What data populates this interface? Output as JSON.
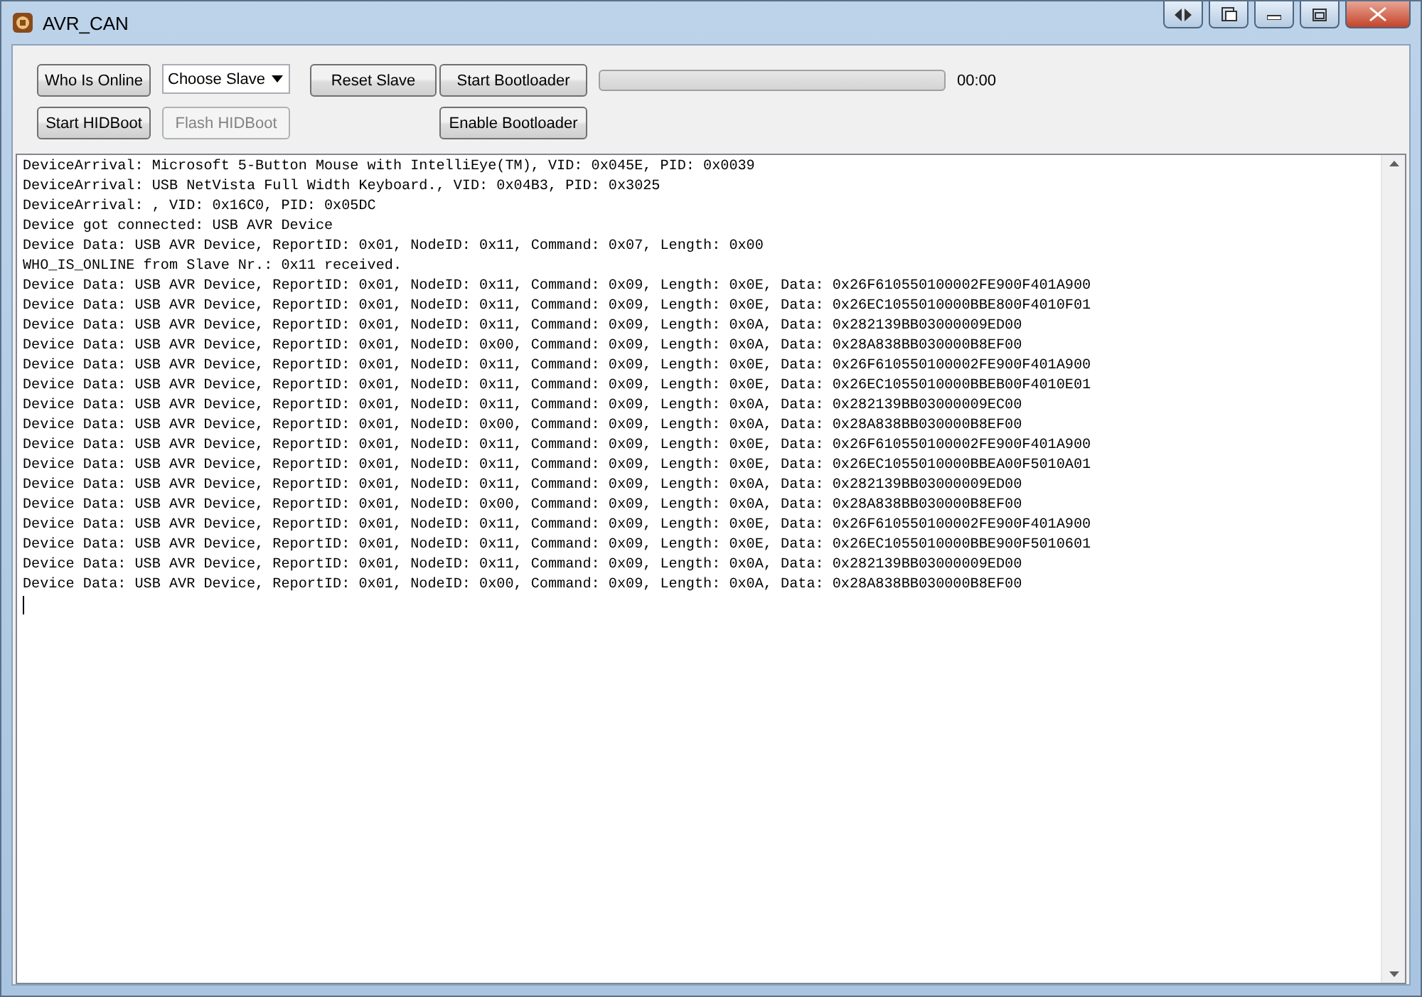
{
  "window": {
    "title": "AVR_CAN"
  },
  "toolbar": {
    "who_is_online": {
      "label": "Who Is Online",
      "disabled": false
    },
    "slave_select": {
      "value": "Choose Slave"
    },
    "reset_slave": {
      "label": "Reset Slave",
      "disabled": false
    },
    "start_bootloader": {
      "label": "Start Bootloader",
      "disabled": false
    },
    "progress": {
      "level": 0
    },
    "elapsed": "00:00",
    "start_hidboot": {
      "label": "Start HIDBoot",
      "disabled": false
    },
    "flash_hidboot": {
      "label": "Flash HIDBoot",
      "disabled": true
    },
    "enable_bootloader": {
      "label": "Enable Bootloader",
      "disabled": false
    }
  },
  "log": {
    "lines": [
      "DeviceArrival: Microsoft 5-Button Mouse with IntelliEye(TM), VID: 0x045E, PID: 0x0039",
      "DeviceArrival: USB NetVista Full Width Keyboard., VID: 0x04B3, PID: 0x3025",
      "DeviceArrival: , VID: 0x16C0, PID: 0x05DC",
      "Device got connected: USB AVR Device",
      "Device Data: USB AVR Device, ReportID: 0x01, NodeID: 0x11, Command: 0x07, Length: 0x00",
      "WHO_IS_ONLINE from Slave Nr.: 0x11 received.",
      "Device Data: USB AVR Device, ReportID: 0x01, NodeID: 0x11, Command: 0x09, Length: 0x0E, Data: 0x26F610550100002FE900F401A900",
      "Device Data: USB AVR Device, ReportID: 0x01, NodeID: 0x11, Command: 0x09, Length: 0x0E, Data: 0x26EC1055010000BBE800F4010F01",
      "Device Data: USB AVR Device, ReportID: 0x01, NodeID: 0x11, Command: 0x09, Length: 0x0A, Data: 0x282139BB03000009ED00",
      "Device Data: USB AVR Device, ReportID: 0x01, NodeID: 0x00, Command: 0x09, Length: 0x0A, Data: 0x28A838BB030000B8EF00",
      "Device Data: USB AVR Device, ReportID: 0x01, NodeID: 0x11, Command: 0x09, Length: 0x0E, Data: 0x26F610550100002FE900F401A900",
      "Device Data: USB AVR Device, ReportID: 0x01, NodeID: 0x11, Command: 0x09, Length: 0x0E, Data: 0x26EC1055010000BBEB00F4010E01",
      "Device Data: USB AVR Device, ReportID: 0x01, NodeID: 0x11, Command: 0x09, Length: 0x0A, Data: 0x282139BB03000009EC00",
      "Device Data: USB AVR Device, ReportID: 0x01, NodeID: 0x00, Command: 0x09, Length: 0x0A, Data: 0x28A838BB030000B8EF00",
      "Device Data: USB AVR Device, ReportID: 0x01, NodeID: 0x11, Command: 0x09, Length: 0x0E, Data: 0x26F610550100002FE900F401A900",
      "Device Data: USB AVR Device, ReportID: 0x01, NodeID: 0x11, Command: 0x09, Length: 0x0E, Data: 0x26EC1055010000BBEA00F5010A01",
      "Device Data: USB AVR Device, ReportID: 0x01, NodeID: 0x11, Command: 0x09, Length: 0x0A, Data: 0x282139BB03000009ED00",
      "Device Data: USB AVR Device, ReportID: 0x01, NodeID: 0x00, Command: 0x09, Length: 0x0A, Data: 0x28A838BB030000B8EF00",
      "Device Data: USB AVR Device, ReportID: 0x01, NodeID: 0x11, Command: 0x09, Length: 0x0E, Data: 0x26F610550100002FE900F401A900",
      "Device Data: USB AVR Device, ReportID: 0x01, NodeID: 0x11, Command: 0x09, Length: 0x0E, Data: 0x26EC1055010000BBE900F5010601",
      "Device Data: USB AVR Device, ReportID: 0x01, NodeID: 0x11, Command: 0x09, Length: 0x0A, Data: 0x282139BB03000009ED00",
      "Device Data: USB AVR Device, ReportID: 0x01, NodeID: 0x00, Command: 0x09, Length: 0x0A, Data: 0x28A838BB030000B8EF00"
    ]
  }
}
